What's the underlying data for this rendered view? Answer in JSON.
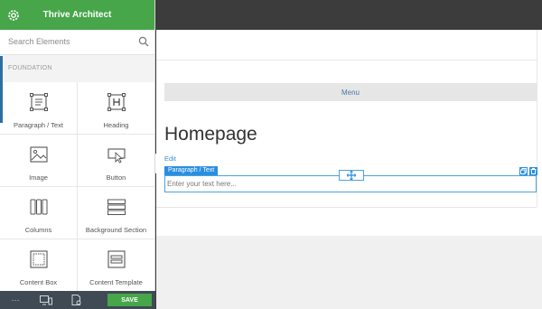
{
  "app": {
    "title": "Thrive Architect"
  },
  "search": {
    "placeholder": "Search Elements"
  },
  "section": {
    "label": "FOUNDATION"
  },
  "elements": [
    {
      "label": "Paragraph / Text",
      "icon": "paragraph-icon"
    },
    {
      "label": "Heading",
      "icon": "heading-icon"
    },
    {
      "label": "Image",
      "icon": "image-icon"
    },
    {
      "label": "Button",
      "icon": "button-icon"
    },
    {
      "label": "Columns",
      "icon": "columns-icon"
    },
    {
      "label": "Background Section",
      "icon": "background-section-icon"
    },
    {
      "label": "Content Box",
      "icon": "content-box-icon"
    },
    {
      "label": "Content Template",
      "icon": "content-template-icon"
    }
  ],
  "footer": {
    "more": "···",
    "save_label": "SAVE"
  },
  "canvas": {
    "menu_label": "Menu",
    "page_title": "Homepage",
    "edit_link": "Edit",
    "selected_tag": "Paragraph / Text",
    "text_placeholder": "Enter your text here..."
  },
  "colors": {
    "brand_green": "#47a54a",
    "accent_blue": "#2a8ee0",
    "footer_dark": "#3f4a55"
  }
}
